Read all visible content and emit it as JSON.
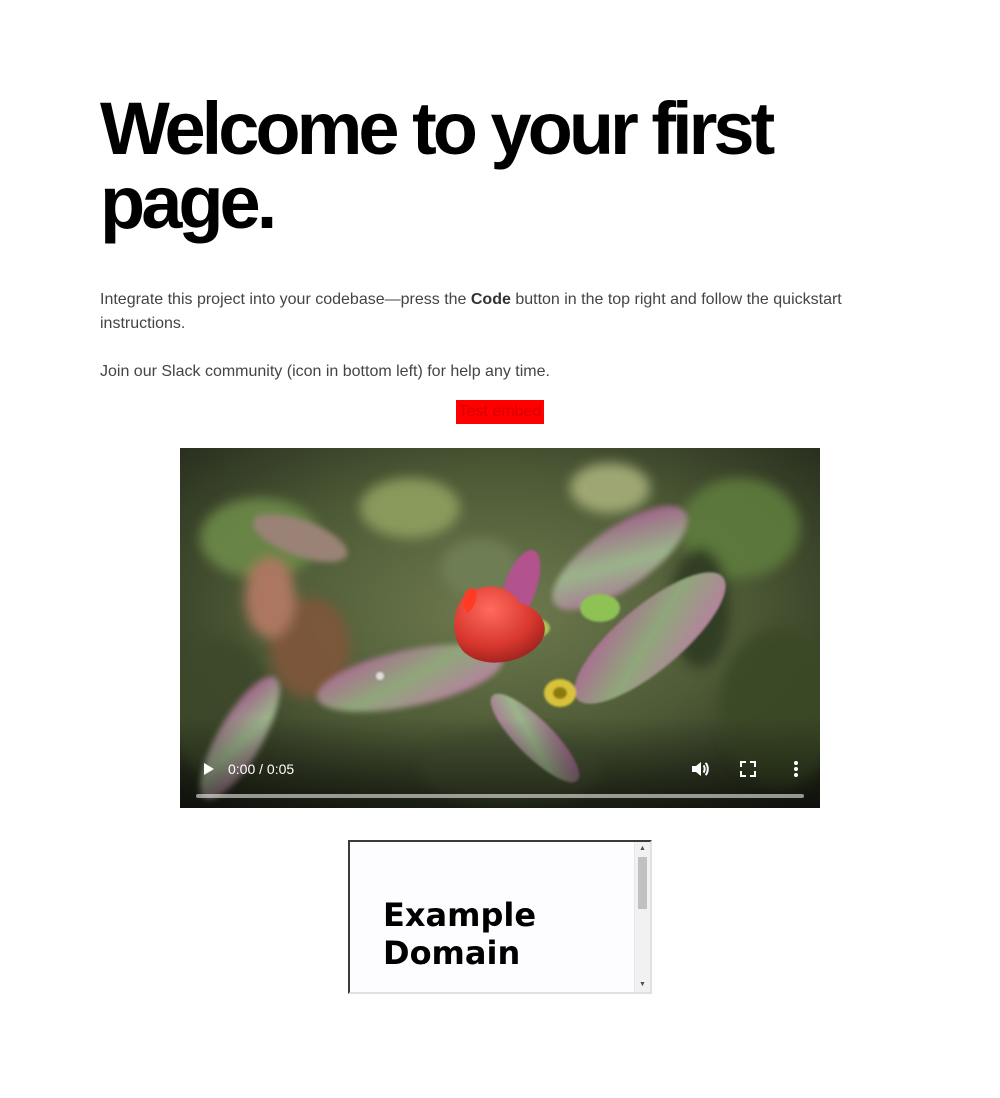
{
  "hero": {
    "title": "Welcome to your first page."
  },
  "intro": {
    "text_before": "Integrate this project into your codebase—press the ",
    "bold_word": "Code",
    "text_after": " button in the top right and follow the quickstart instructions.",
    "community": "Join our Slack community (icon in bottom left) for help any time."
  },
  "embed": {
    "label": "Test embed",
    "background": "#ff0000",
    "text_color": "#d60000"
  },
  "video": {
    "time_display": "0:00 / 0:05",
    "progress": 0,
    "icons": {
      "play": "play-icon",
      "volume": "volume-icon",
      "fullscreen": "fullscreen-icon",
      "more": "more-vertical-icon"
    }
  },
  "iframe": {
    "heading": "Example Domain",
    "background": "#fdfdff"
  }
}
